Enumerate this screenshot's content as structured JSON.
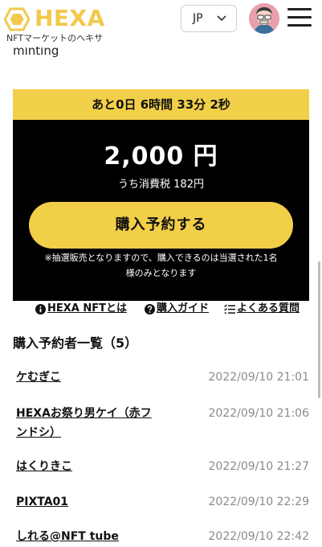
{
  "header": {
    "logo_text": "HEXA",
    "tagline": "NFTマーケットのヘキサ",
    "language": "JP"
  },
  "cut_text": "minting",
  "card": {
    "countdown": "あと0日 6時間 33分 2秒",
    "price": "2,000 円",
    "tax_note": "うち消費税 182円",
    "buy_button": "購入予約する",
    "notice_line1": "※抽選販売となりますので、購入できるのは当選された1名",
    "notice_line2": "様のみとなります"
  },
  "links": {
    "about": "HEXA NFTとは",
    "guide": "購入ガイド",
    "faq": "よくある質問"
  },
  "reservations": {
    "title": "購入予約者一覧（5）",
    "rows": [
      {
        "name": "ケむぎこ",
        "date": "2022/09/10 21:01"
      },
      {
        "name": "HEXAお祭り男ケイ（赤フンドシ）",
        "name_line1": "HEXAお祭り男ケイ（赤フ",
        "name_line2": "ンドシ）",
        "date": "2022/09/10 21:06"
      },
      {
        "name": "はくりきこ",
        "date": "2022/09/10 21:27"
      },
      {
        "name": "PIXTA01",
        "date": "2022/09/10 22:29"
      },
      {
        "name": "しれる@NFT tube",
        "date": "2022/09/10 22:42"
      }
    ]
  },
  "colors": {
    "accent_yellow": "#f2cf48",
    "logo_yellow": "#f2c94c",
    "card_bg": "#000000",
    "date_gray": "#8a8a8a"
  },
  "icons": [
    "hexagon-logo-icon",
    "chevron-down-icon",
    "avatar",
    "hamburger-menu-icon",
    "info-icon",
    "question-icon",
    "list-icon"
  ]
}
